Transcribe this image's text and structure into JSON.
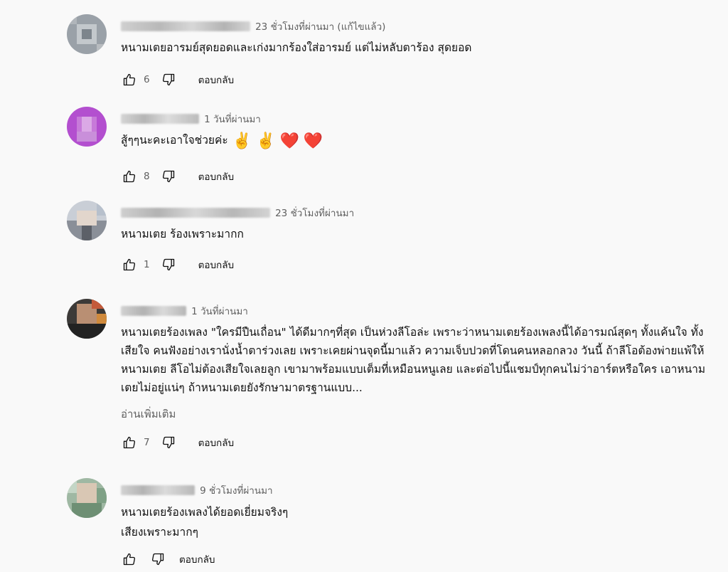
{
  "comments": [
    {
      "time": "23 ชั่วโมงที่ผ่านมา (แก้ไขแล้ว)",
      "text": "หนามเตยอารมย์สุดยอดและเก่งมากร้องใส่อารมย์ แต่ไม่หลับตาร้อง สุดยอด",
      "likes": "6",
      "reply_label": "ตอบกลับ"
    },
    {
      "time": "1 วันที่ผ่านมา",
      "text": "สู้ๆๆนะคะเอาใจช่วยค่ะ",
      "emojis": [
        "✌️",
        "✌️",
        "❤️",
        "❤️"
      ],
      "likes": "8",
      "reply_label": "ตอบกลับ"
    },
    {
      "time": "23 ชั่วโมงที่ผ่านมา",
      "text": "หนามเตย ร้องเพราะมากก",
      "likes": "1",
      "reply_label": "ตอบกลับ"
    },
    {
      "time": "1 วันที่ผ่านมา",
      "text": "หนามเตยร้องเพลง \"ใครมีปืนเถื่อน\" ได้ดีมากๆที่สุด เป็นห่วงลีโอล่ะ เพราะว่าหนามเตยร้องเพลงนี้ได้อารมณ์สุดๆ ทั้งแค้นใจ ทั้งเสียใจ คนฟังอย่างเรานั่งน้ำตาร่วงเลย เพราะเคยผ่านจุดนี้มาแล้ว ความเจ็บปวดที่โดนคนหลอกลวง วันนี้ ถ้าลีโอต้องพ่ายแพ้ให้หนามเตย ลีโอไม่ต้องเสียใจเลยลูก เขามาพร้อมแบบเต็มที่เหมือนหนูเลย และต่อไปนี้แชมป์ทุกคนไม่ว่าอาร์ตหรือใคร เอาหนามเตยไม่อยู่แน่ๆ ถ้าหนามเตยยังรักษามาตรฐานแบบ...",
      "read_more": "อ่านเพิ่มเติม",
      "likes": "7",
      "reply_label": "ตอบกลับ"
    },
    {
      "time": "9 ชั่วโมงที่ผ่านมา",
      "lines": [
        "หนามเตยร้องเพลงได้ยอดเยี่ยมจริงๆ",
        "เสียงเพราะมากๆ"
      ],
      "likes": "",
      "reply_label": "ตอบกลับ"
    }
  ],
  "icons": {
    "like": "thumbs-up-icon",
    "dislike": "thumbs-down-icon"
  },
  "colors": {
    "background": "#f9f9f9",
    "secondary_text": "#606060",
    "primary_text": "#0f0f0f"
  }
}
